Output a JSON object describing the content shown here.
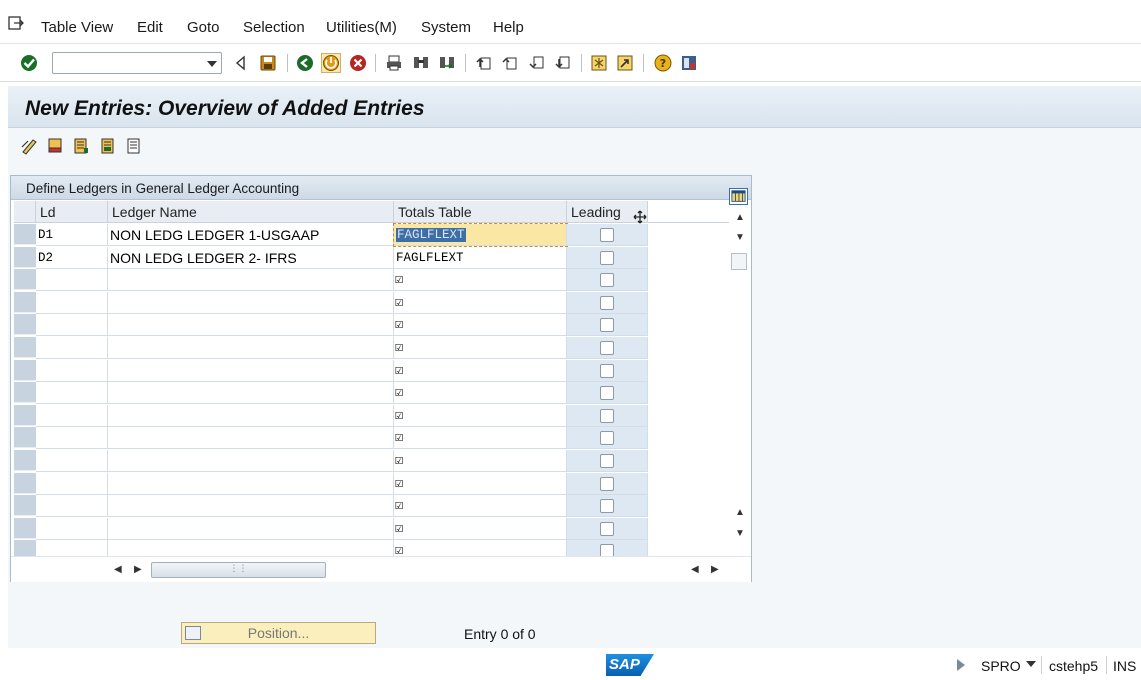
{
  "menu": {
    "items": [
      "Table View",
      "Edit",
      "Goto",
      "Selection",
      "Utilities(M)",
      "System",
      "Help"
    ]
  },
  "toolbar": {
    "command_field_value": ""
  },
  "page": {
    "title": "New Entries: Overview of Added Entries"
  },
  "table": {
    "title": "Define Ledgers in General Ledger Accounting",
    "columns": [
      "Ld",
      "Ledger Name",
      "Totals Table",
      "Leading"
    ],
    "rows": [
      {
        "ld": "D1",
        "name": "NON LEDG LEDGER 1-USGAAP",
        "totals": "FAGLFLEXT",
        "leading": false
      },
      {
        "ld": "D2",
        "name": "NON LEDG LEDGER 2- IFRS",
        "totals": "FAGLFLEXT",
        "leading": false
      }
    ],
    "empty_row_count": 13
  },
  "footer": {
    "position_label": "Position...",
    "entry_text": "Entry 0 of 0"
  },
  "status": {
    "logo": "SAP",
    "transaction": "SPRO",
    "server": "cstehp5",
    "mode": "INS"
  }
}
